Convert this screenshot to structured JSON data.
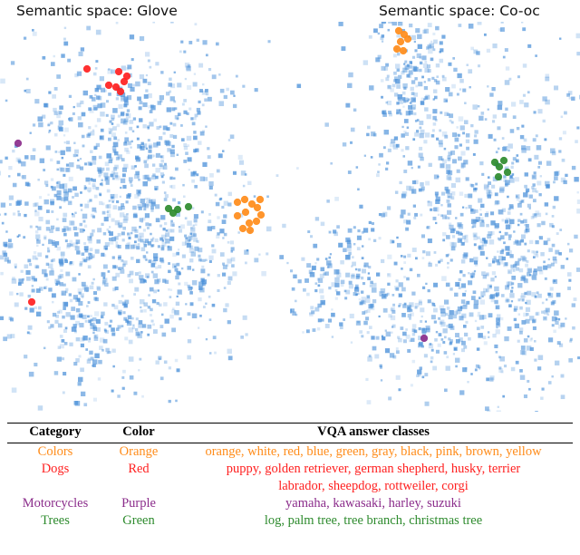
{
  "panels": [
    {
      "title": "Semantic space: Glove"
    },
    {
      "title": "Semantic space: Co-oc"
    }
  ],
  "table": {
    "headers": {
      "category": "Category",
      "color": "Color",
      "classes": "VQA answer classes"
    },
    "rows": [
      {
        "category": "Colors",
        "color_name": "Orange",
        "color_hex": "#FF8C1A",
        "classes": "orange, white, red, blue, green, gray, black, pink, brown, yellow",
        "classes_line2": ""
      },
      {
        "category": "Dogs",
        "color_name": "Red",
        "color_hex": "#FF2020",
        "classes": "puppy, golden retriever, german shepherd, husky, terrier",
        "classes_line2": "labrador, sheepdog, rottweiler, corgi"
      },
      {
        "category": "Motorcycles",
        "color_name": "Purple",
        "color_hex": "#8B2D8B",
        "classes": "yamaha, kawasaki, harley, suzuki",
        "classes_line2": ""
      },
      {
        "category": "Trees",
        "color_name": "Green",
        "color_hex": "#2E8B2E",
        "classes": "log, palm tree, tree branch, christmas tree",
        "classes_line2": ""
      }
    ]
  },
  "chart_data": {
    "type": "scatter",
    "title": "Semantic space embeddings (t-SNE style projections)",
    "xlabel": "",
    "ylabel": "",
    "grid": false,
    "legend_position": "below-as-table",
    "background_color": "#4A90D9",
    "background_point_marker": "square",
    "panels": [
      {
        "name": "Semantic space: Glove",
        "x_range": [
          0,
          320
        ],
        "y_range": [
          0,
          430
        ],
        "background_points": 1450,
        "background_seed": 17,
        "background_blobs": [
          {
            "cx": 120,
            "cy": 200,
            "sx": 72,
            "sy": 96,
            "weight": 0.62
          },
          {
            "cx": 90,
            "cy": 300,
            "sx": 58,
            "sy": 60,
            "weight": 0.2
          },
          {
            "cx": 175,
            "cy": 120,
            "sx": 52,
            "sy": 52,
            "weight": 0.11
          },
          {
            "cx": 215,
            "cy": 260,
            "sx": 40,
            "sy": 40,
            "weight": 0.07
          }
        ],
        "highlight_series": [
          {
            "name": "Colors",
            "color": "#FF8C1A",
            "points": [
              [
                262,
                199
              ],
              [
                270,
                196
              ],
              [
                278,
                201
              ],
              [
                284,
                205
              ],
              [
                288,
                213
              ],
              [
                283,
                220
              ],
              [
                275,
                222
              ],
              [
                268,
                228
              ],
              [
                276,
                230
              ],
              [
                262,
                214
              ],
              [
                287,
                196
              ],
              [
                271,
                210
              ]
            ]
          },
          {
            "name": "Dogs",
            "color": "#FF2020",
            "points": [
              [
                96,
                52
              ],
              [
                131,
                55
              ],
              [
                140,
                60
              ],
              [
                137,
                66
              ],
              [
                128,
                72
              ],
              [
                120,
                70
              ],
              [
                133,
                77
              ],
              [
                35,
                309
              ]
            ]
          },
          {
            "name": "Motorcycles",
            "color": "#8B2D8B",
            "points": [
              [
                20,
                134
              ]
            ]
          },
          {
            "name": "Trees",
            "color": "#2E8B2E",
            "points": [
              [
                186,
                206
              ],
              [
                191,
                211
              ],
              [
                196,
                207
              ],
              [
                208,
                204
              ]
            ]
          }
        ]
      },
      {
        "name": "Semantic space: Co-oc",
        "x_range": [
          0,
          320
        ],
        "y_range": [
          0,
          430
        ],
        "background_points": 1450,
        "background_seed": 43,
        "background_blobs": [
          {
            "cx": 200,
            "cy": 210,
            "sx": 66,
            "sy": 100,
            "weight": 0.52
          },
          {
            "cx": 245,
            "cy": 300,
            "sx": 48,
            "sy": 62,
            "weight": 0.16
          },
          {
            "cx": 130,
            "cy": 60,
            "sx": 26,
            "sy": 44,
            "weight": 0.12
          },
          {
            "cx": 60,
            "cy": 290,
            "sx": 34,
            "sy": 30,
            "weight": 0.12
          },
          {
            "cx": 150,
            "cy": 345,
            "sx": 40,
            "sy": 34,
            "weight": 0.08
          }
        ],
        "highlight_series": [
          {
            "name": "Colors",
            "color": "#FF8C1A",
            "points": [
              [
                120,
                10
              ],
              [
                126,
                14
              ],
              [
                122,
                22
              ],
              [
                118,
                30
              ],
              [
                125,
                32
              ],
              [
                130,
                19
              ]
            ]
          },
          {
            "name": "Dogs",
            "color": "#FF2020",
            "points": []
          },
          {
            "name": "Motorcycles",
            "color": "#8B2D8B",
            "points": [
              [
                148,
                349
              ]
            ]
          },
          {
            "name": "Trees",
            "color": "#2E8B2E",
            "points": [
              [
                226,
                155
              ],
              [
                231,
                160
              ],
              [
                236,
                153
              ],
              [
                230,
                171
              ],
              [
                240,
                166
              ]
            ]
          }
        ]
      }
    ]
  }
}
